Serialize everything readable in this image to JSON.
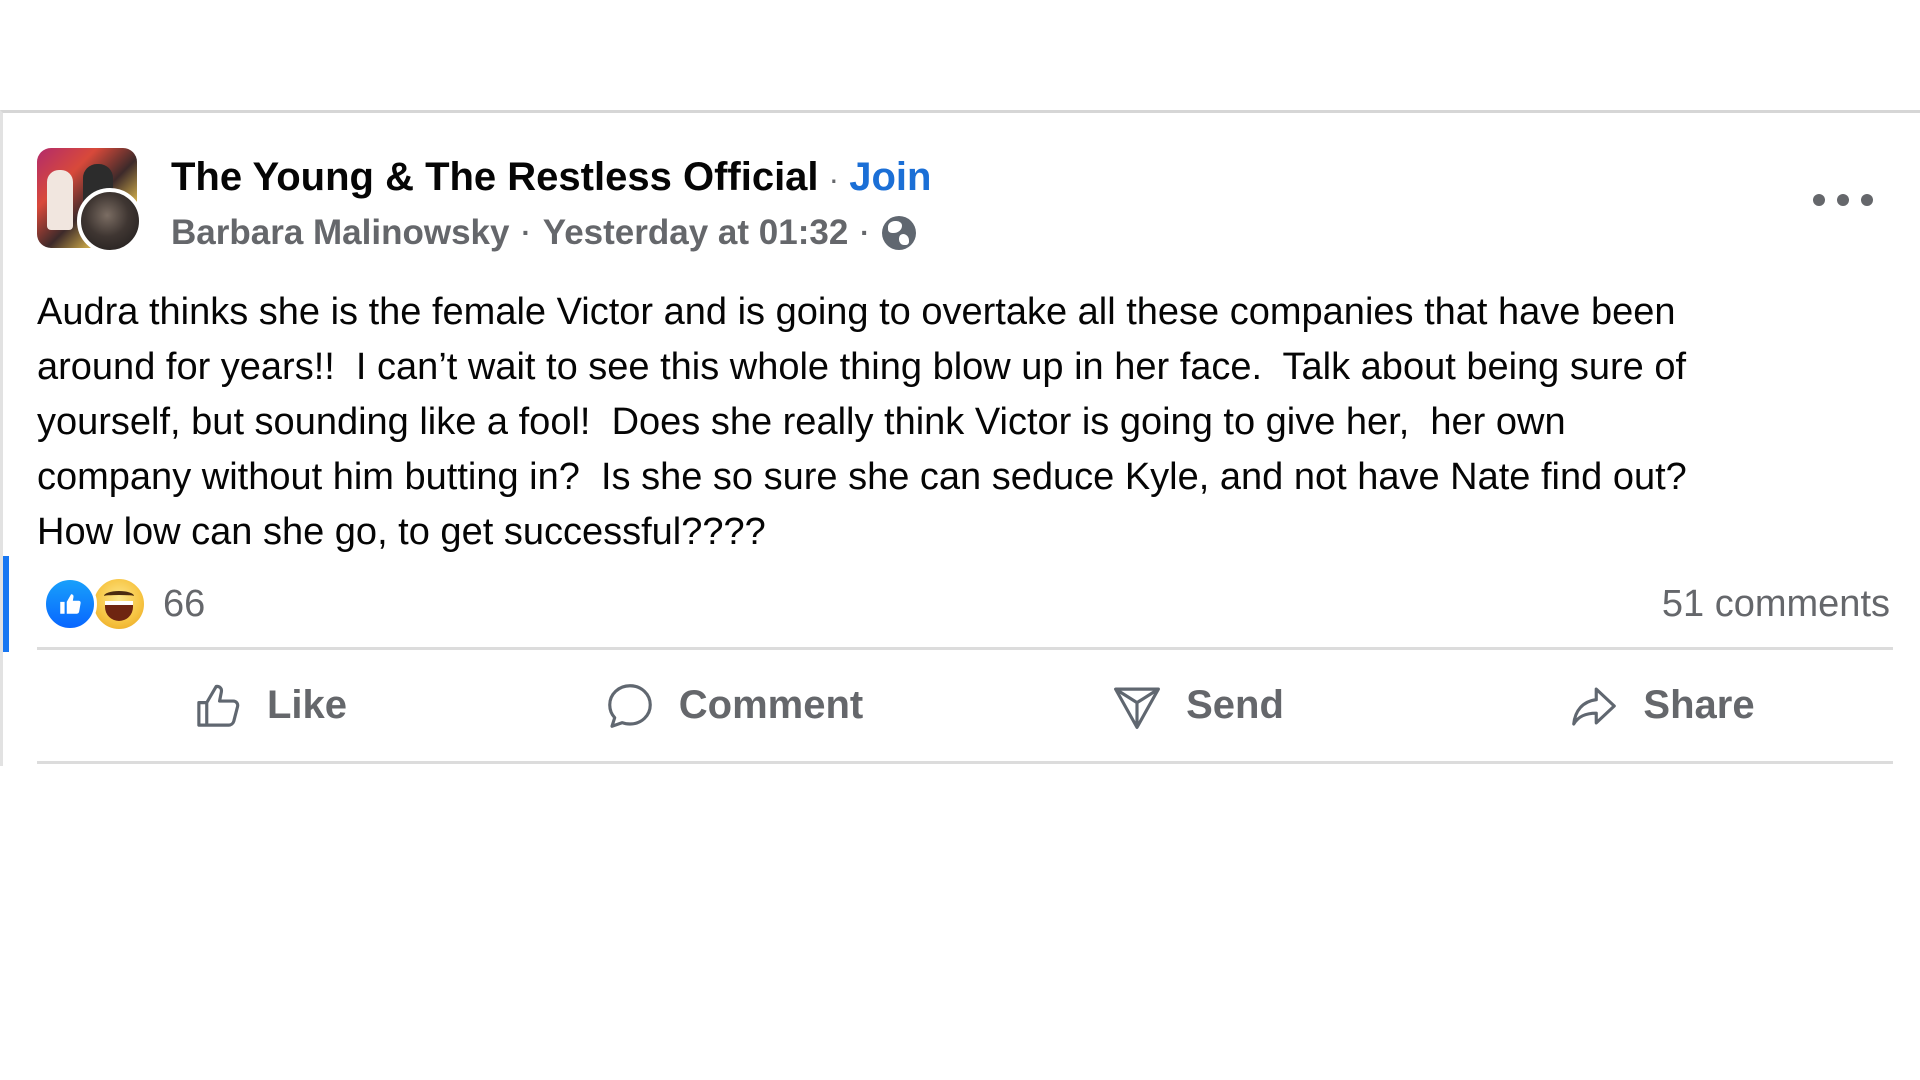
{
  "post": {
    "group_name": "The Young & The Restless Official",
    "separator": "·",
    "join_label": "Join",
    "author": "Barbara Malinowsky",
    "timestamp": "Yesterday at 01:32",
    "privacy_icon": "globe-icon",
    "more_icon": "more-options-icon",
    "text": "Audra thinks she is the female Victor and is going to overtake all these companies that have been\naround for years!!  I can’t wait to see this whole thing blow up in her face.  Talk about being sure of\nyourself, but sounding like a fool!  Does she really think Victor is going to give her,  her own\ncompany without him butting in?  Is she so sure she can seduce Kyle, and not have Nate find out?\nHow low can she go, to get successful????"
  },
  "reactions": {
    "types": [
      "like",
      "haha"
    ],
    "count": "66",
    "comments": "51 comments"
  },
  "actions": {
    "like": "Like",
    "comment": "Comment",
    "send": "Send",
    "share": "Share"
  },
  "colors": {
    "accent": "#1877f2",
    "join": "#1b6fd6",
    "secondary_text": "#65676b"
  }
}
